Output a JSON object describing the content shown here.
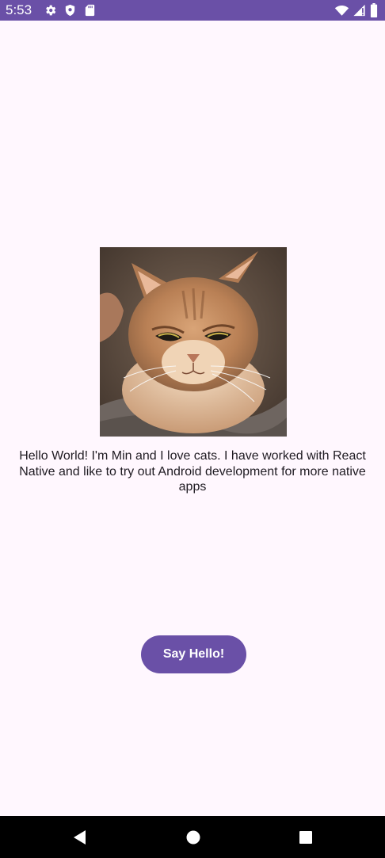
{
  "status_bar": {
    "time": "5:53",
    "left_icons": [
      "gear-icon",
      "shield-icon",
      "sd-card-icon"
    ],
    "right_icons": [
      "wifi-icon",
      "cell-signal-icon",
      "battery-icon"
    ],
    "background": "#6A50A7"
  },
  "main": {
    "image_alt": "cat photo",
    "intro_text": "Hello World! I'm Min and I love cats. I have worked with React Native and like to try out Android development for more native apps",
    "button_label": "Say Hello!"
  },
  "nav_bar": {
    "buttons": [
      "back-icon",
      "home-icon",
      "recent-apps-icon"
    ]
  },
  "colors": {
    "accent": "#6A50A7",
    "background": "#FFF7FE",
    "text": "#1F1B22"
  }
}
